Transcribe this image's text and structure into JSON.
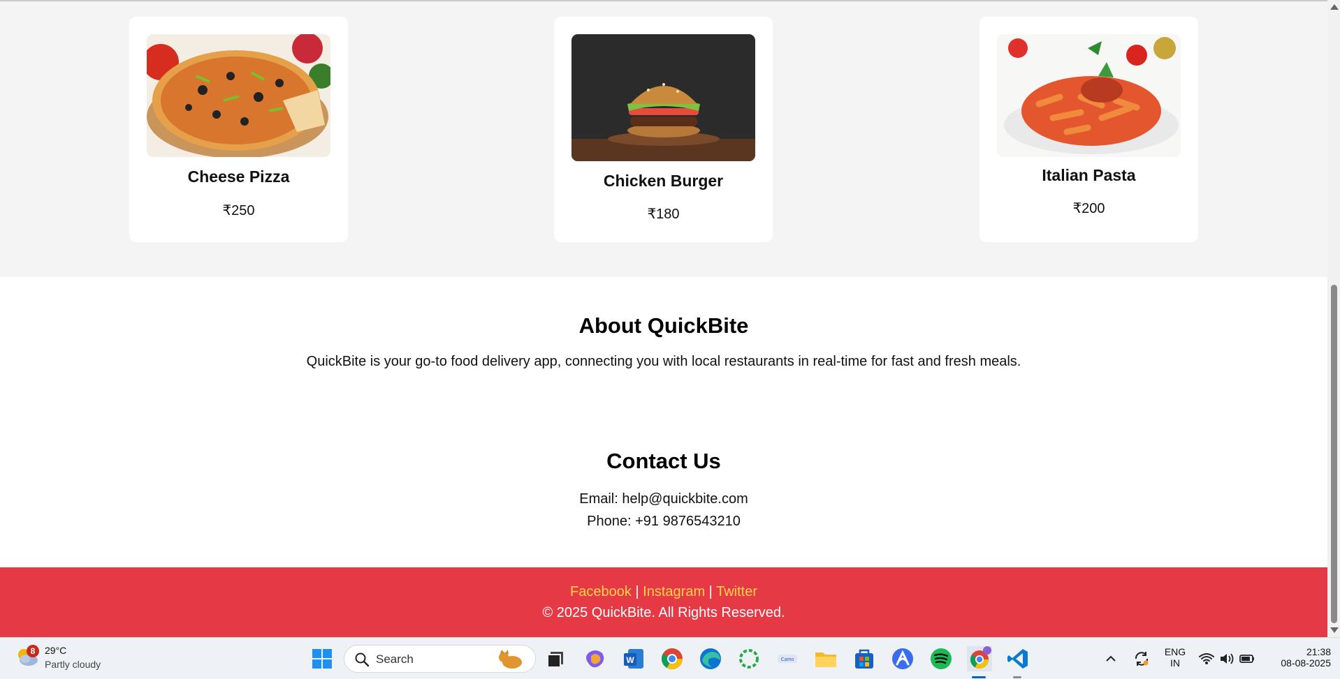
{
  "menu": {
    "items": [
      {
        "name": "Cheese Pizza",
        "price": "₹250"
      },
      {
        "name": "Chicken Burger",
        "price": "₹180"
      },
      {
        "name": "Italian Pasta",
        "price": "₹200"
      }
    ]
  },
  "about": {
    "title": "About QuickBite",
    "text": "QuickBite is your go-to food delivery app, connecting you with local restaurants in real-time for fast and fresh meals."
  },
  "contact": {
    "title": "Contact Us",
    "email": "Email: help@quickbite.com",
    "phone": "Phone: +91 9876543210"
  },
  "footer": {
    "links": [
      "Facebook",
      "Instagram",
      "Twitter"
    ],
    "separator": "|",
    "copyright": "© 2025 QuickBite. All Rights Reserved."
  },
  "taskbar": {
    "weather": {
      "badge": "8",
      "temp": "29°C",
      "condition": "Partly cloudy"
    },
    "search_placeholder": "Search",
    "lang": "ENG",
    "region": "IN",
    "time": "21:38",
    "date": "08-08-2025",
    "apps": [
      "task-view-icon",
      "copilot-icon",
      "word-icon",
      "chrome-icon",
      "edge-icon",
      "circle-app-icon",
      "camo-icon",
      "file-explorer-icon",
      "store-icon",
      "arc-icon",
      "spotify-icon",
      "chrome-profile-icon",
      "vscode-icon"
    ]
  },
  "colors": {
    "footer_bg": "#e63946",
    "footer_link": "#ffd447",
    "section_bg": "#f4f4f4"
  }
}
